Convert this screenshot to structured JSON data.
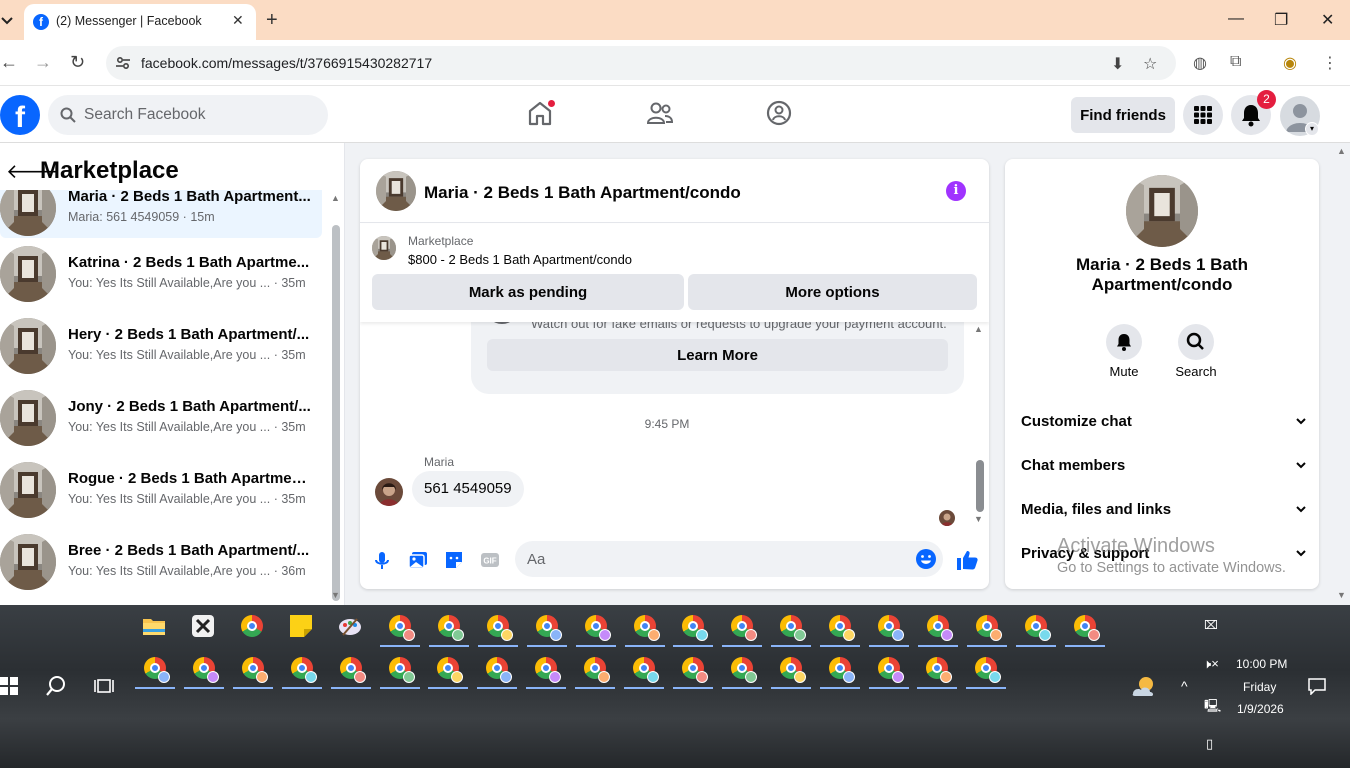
{
  "browser": {
    "tab_title": "(2) Messenger | Facebook",
    "url": "facebook.com/messages/t/3766915430282717"
  },
  "fb_header": {
    "search_placeholder": "Search Facebook",
    "find_friends_label": "Find friends",
    "notification_count": "2"
  },
  "sidebar": {
    "title": "Marketplace",
    "conversations": [
      {
        "name": "Maria · 2 Beds 1 Bath Apartment...",
        "snippet": "Maria: 561 4549059",
        "time": "15m",
        "active": true
      },
      {
        "name": "Katrina · 2 Beds 1 Bath Apartme...",
        "snippet": "You: Yes Its Still Available,Are you ...",
        "time": "35m"
      },
      {
        "name": "Hery · 2 Beds 1 Bath Apartment/...",
        "snippet": "You: Yes Its Still Available,Are you ...",
        "time": "35m"
      },
      {
        "name": "Jony · 2 Beds 1 Bath Apartment/...",
        "snippet": "You: Yes Its Still Available,Are you ...",
        "time": "35m"
      },
      {
        "name": "Rogue · 2 Beds 1 Bath Apartmen...",
        "snippet": "You: Yes Its Still Available,Are you ...",
        "time": "35m"
      },
      {
        "name": "Bree · 2 Beds 1 Bath Apartment/...",
        "snippet": "You: Yes Its Still Available,Are you ...",
        "time": "36m"
      }
    ]
  },
  "chat": {
    "title": "Maria · 2 Beds 1 Bath Apartment/condo",
    "marketplace_label": "Marketplace",
    "listing": "$800 - 2 Beds 1 Bath Apartment/condo",
    "mark_pending_label": "Mark as pending",
    "more_options_label": "More options",
    "warning_text": "Watch out for fake emails or requests to upgrade your payment account.",
    "learn_more_label": "Learn More",
    "time_separator": "9:45 PM",
    "sender_name": "Maria",
    "message_text": "561 4549059",
    "composer_placeholder": "Aa"
  },
  "info_panel": {
    "name": "Maria · 2 Beds 1 Bath Apartment/condo",
    "mute_label": "Mute",
    "search_label": "Search",
    "rows": [
      "Customize chat",
      "Chat members",
      "Media, files and links",
      "Privacy & support"
    ]
  },
  "watermark": {
    "line1": "Activate Windows",
    "line2": "Go to Settings to activate Windows."
  },
  "taskbar": {
    "time": "10:00 PM",
    "day": "Friday",
    "date": "1/9/2026"
  },
  "colors": {
    "fb_blue": "#0866ff",
    "info_purple": "#a033ff",
    "badge_red": "#e41e3f",
    "tabstrip_peach": "#fbdcc4"
  }
}
